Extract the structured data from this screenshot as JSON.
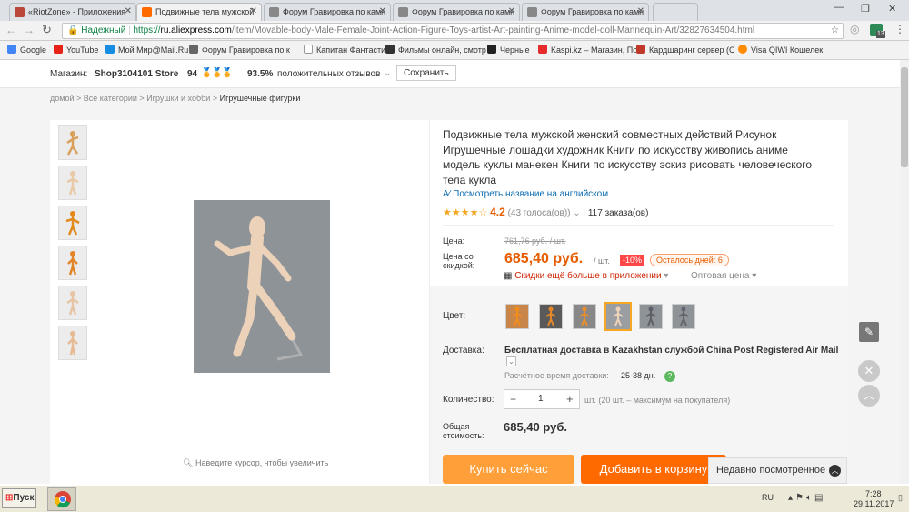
{
  "browser": {
    "tabs": [
      {
        "label": "«RiotZone» - Приложения"
      },
      {
        "label": "Подвижные тела мужской"
      },
      {
        "label": "Форум Гравировка по камн"
      },
      {
        "label": "Форум Гравировка по камн"
      },
      {
        "label": "Форум Гравировка по камн"
      }
    ],
    "secure_label": "Надежный",
    "url_prefix": "https://",
    "url_host": "ru.aliexpress.com",
    "url_path": "/item/Movable-body-Male-Female-Joint-Action-Figure-Toys-artist-Art-painting-Anime-model-doll-Mannequin-Art/32827634504.html",
    "bookmarks": [
      {
        "label": "Google",
        "color": "#4285f4"
      },
      {
        "label": "YouTube",
        "color": "#e62117"
      },
      {
        "label": "Мой Мир@Mail.Ru",
        "color": "#168de2"
      },
      {
        "label": "Форум Гравировка по к",
        "color": "#666"
      },
      {
        "label": "Капитан Фантастик",
        "color": "#999"
      },
      {
        "label": "Фильмы онлайн, смотр",
        "color": "#333"
      },
      {
        "label": "Черные",
        "color": "#222"
      },
      {
        "label": "Kaspi.kz – Магазин, По",
        "color": "#e52b2b"
      },
      {
        "label": "Кардшаринг сервер (С",
        "color": "#c0392b"
      },
      {
        "label": "Visa QIWI Кошелек",
        "color": "#ff8c00"
      }
    ],
    "extension_badge": "13"
  },
  "store": {
    "label": "Магазин:",
    "name": "Shop3104101 Store",
    "score": "94",
    "percent": "93.5%",
    "feedback": "положительных отзывов",
    "save": "Сохранить"
  },
  "breadcrumbs": [
    "домой",
    "Все категории",
    "Игрушки и хобби",
    "Игрушечные фигурки"
  ],
  "product": {
    "title_lines": [
      "Подвижные тела мужской женский совместных действий Рисунок",
      "Игрушечные лошадки художник Книги по искусству живопись аниме",
      "модель куклы манекен Книги по искусству эскиз рисовать человеческого",
      "тела кукла"
    ],
    "translate_link": "Посмотреть название на английском",
    "rating": "4.2",
    "rating_stars": 4.2,
    "votes": "(43 голоса(ов))",
    "orders": "117 заказа(ов)",
    "zoom_hint": "Наведите курсор, чтобы увеличить"
  },
  "price": {
    "price_label": "Цена:",
    "old_price": "761,76 руб. / шт.",
    "discount_label_1": "Цена со",
    "discount_label_2": "скидкой:",
    "new_price": "685,40 руб.",
    "unit": "/ шт.",
    "discount_badge": "-10%",
    "days_left": "Осталось дней: 6",
    "app_discount": "Скидки ещё больше в приложении",
    "wholesale": "Оптовая цена"
  },
  "options": {
    "color_label": "Цвет:",
    "delivery_label": "Доставка:",
    "delivery_text": "Бесплатная доставка в Kazakhstan службой China Post Registered Air Mail",
    "delivery_time_label": "Расчётное время доставки:",
    "delivery_time": "25-38 дн.",
    "qty_label": "Количество:",
    "qty_minus": "−",
    "qty_value": "1",
    "qty_plus": "+",
    "qty_note": "шт. (20 шт. – максимум на покупателя)",
    "total_label_1": "Общая",
    "total_label_2": "стоимость:",
    "total_value": "685,40 руб."
  },
  "actions": {
    "buy_now": "Купить сейчас",
    "add_to_cart": "Добавить в корзину",
    "recently_viewed": "Недавно посмотренное"
  },
  "taskbar": {
    "start": "Пуск",
    "lang": "RU",
    "time": "7:28",
    "date": "29.11.2017"
  },
  "colors": {
    "accent": "#ff4747",
    "price_orange": "#e65c00",
    "buy_orange": "#ff9f3a",
    "cart_orange": "#ff6a00",
    "link_blue": "#0a6ab0"
  }
}
